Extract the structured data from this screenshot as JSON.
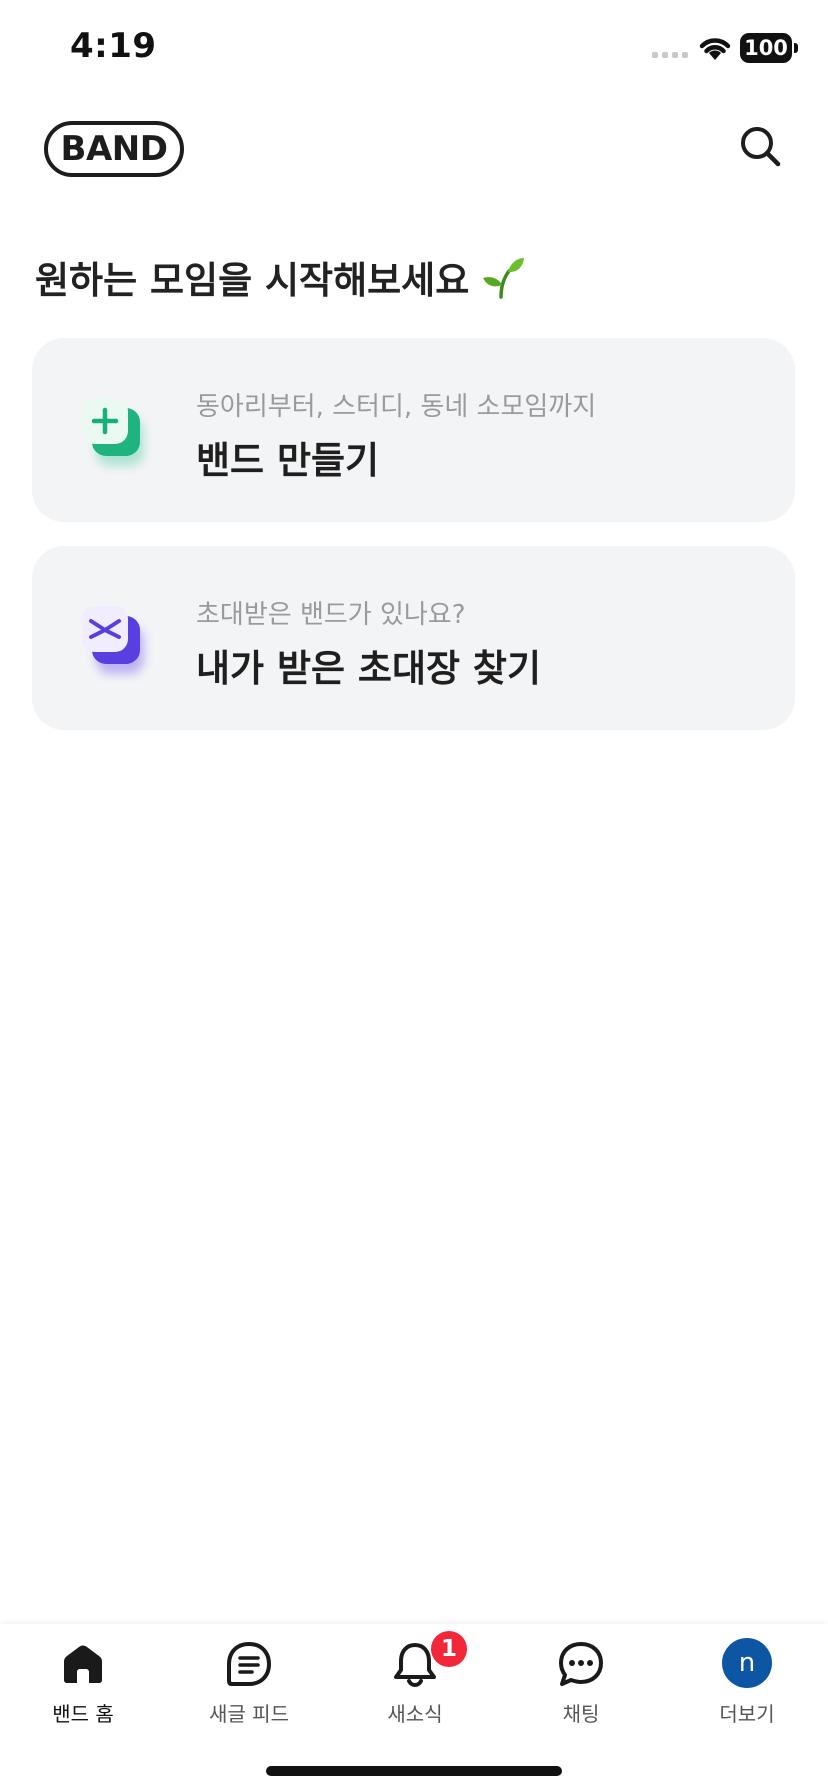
{
  "status_bar": {
    "time": "4:19",
    "battery": "100"
  },
  "header": {
    "logo_text": "BAND",
    "search_icon": "search-icon"
  },
  "main": {
    "headline": "원하는 모임을 시작해보세요",
    "headline_emoji": "sprout-icon",
    "cards": [
      {
        "subtitle": "동아리부터, 스터디, 동네 소모임까지",
        "title": "밴드 만들기",
        "icon": "create-band-icon",
        "accent": "#2bc48f"
      },
      {
        "subtitle": "초대받은 밴드가 있나요?",
        "title": "내가 받은 초대장 찾기",
        "icon": "invitation-icon",
        "accent": "#6a4ff0"
      }
    ]
  },
  "tab_bar": {
    "tabs": [
      {
        "label": "밴드 홈",
        "icon": "home-icon",
        "active": true
      },
      {
        "label": "새글 피드",
        "icon": "feed-icon"
      },
      {
        "label": "새소식",
        "icon": "bell-icon",
        "badge": "1"
      },
      {
        "label": "채팅",
        "icon": "chat-icon"
      },
      {
        "label": "더보기",
        "icon": "avatar",
        "avatar_letter": "n",
        "avatar_color": "#0c56a3"
      }
    ]
  }
}
